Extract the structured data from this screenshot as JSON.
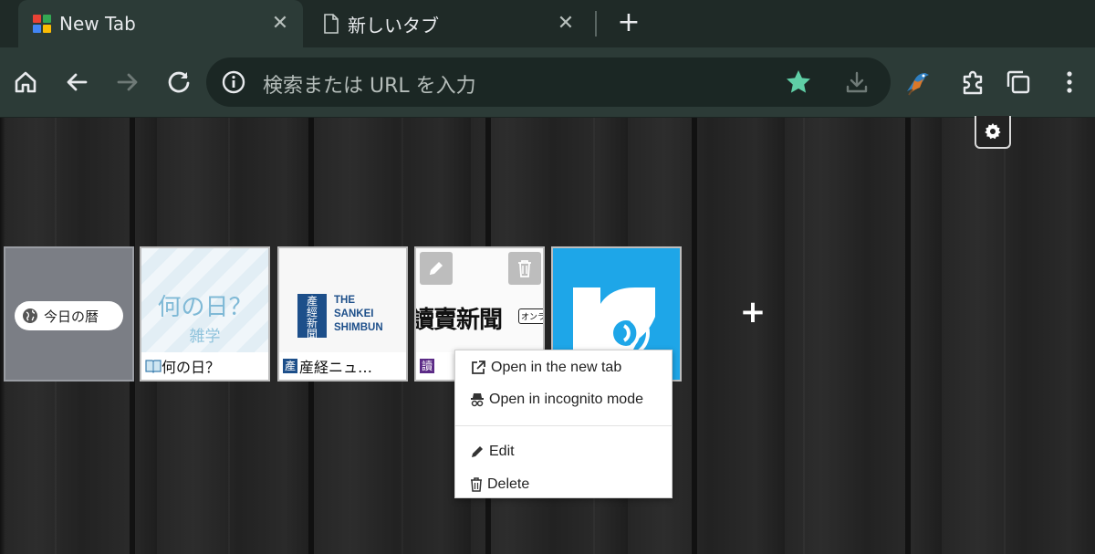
{
  "tabs": [
    {
      "title": "New Tab",
      "active": true,
      "favicon": "grid-icon"
    },
    {
      "title": "新しいタブ",
      "active": false,
      "favicon": "document-icon"
    }
  ],
  "toolbar": {
    "omnibox_placeholder": "検索または URL を入力",
    "icons": [
      "home-icon",
      "back-icon",
      "forward-icon",
      "reload-icon",
      "info-icon",
      "star-icon",
      "download-icon",
      "bird-icon",
      "extensions-icon",
      "tab-search-icon",
      "menu-icon"
    ],
    "star_color": "#5fcfa6"
  },
  "speed_dial": {
    "tiles": [
      {
        "pill_label": "今日の暦",
        "caption": ""
      },
      {
        "img_title": "何の日？",
        "img_subtitle": "雑学",
        "caption": "何の日？"
      },
      {
        "img_logo_line1": "THE",
        "img_logo_line2": "SANKEI",
        "img_logo_line3": "SHIMBUN",
        "caption": "産経ニュ…"
      },
      {
        "img_logo": "讀賣新聞",
        "img_tag": "オンライ",
        "caption": "讀"
      },
      {
        "caption": ""
      }
    ],
    "add_label": "+"
  },
  "context_menu": {
    "items": [
      {
        "label": "Open in the new tab",
        "icon": "external-link-icon"
      },
      {
        "label": "Open in incognito mode",
        "icon": "incognito-icon"
      },
      {
        "label": "Edit",
        "icon": "pencil-icon"
      },
      {
        "label": "Delete",
        "icon": "trash-icon"
      }
    ]
  },
  "colors": {
    "tab_strip": "#1f2a27",
    "toolbar": "#2c3b37",
    "omnibox": "#1b2724",
    "radiko_blue": "#1ea6e8",
    "sankei_blue": "#1d4f8a"
  }
}
